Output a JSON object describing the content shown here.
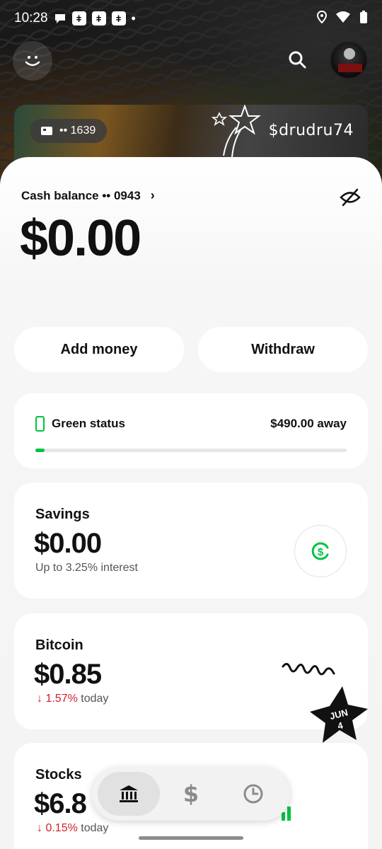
{
  "status_bar": {
    "time": "10:28",
    "dot": "•"
  },
  "header": {
    "menu_icon": "smiley-icon",
    "search_icon": "search-icon",
    "avatar": "profile-avatar"
  },
  "card": {
    "number_masked": "•• 1639",
    "cashtag": "$drudru74"
  },
  "balance": {
    "label": "Cash balance •• 0943",
    "chevron": "›",
    "amount": "$0.00"
  },
  "actions": {
    "add_money": "Add money",
    "withdraw": "Withdraw"
  },
  "green_status": {
    "label": "Green status",
    "away": "$490.00 away",
    "progress_fraction": 0.03,
    "accent": "#00c244"
  },
  "savings": {
    "title": "Savings",
    "amount": "$0.00",
    "subtitle": "Up to 3.25% interest"
  },
  "bitcoin": {
    "title": "Bitcoin",
    "amount": "$0.85",
    "change_arrow": "↓",
    "change_pct": "1.57%",
    "change_suffix": "today"
  },
  "stocks": {
    "title": "Stocks",
    "amount": "$6.8",
    "change_arrow": "↓",
    "change_pct": "0.15%",
    "change_suffix": "today"
  },
  "sticker": {
    "line1": "JUN",
    "line2": "4"
  },
  "nav": {
    "items": [
      {
        "name": "bank-icon",
        "active": true
      },
      {
        "name": "dollar-icon",
        "glyph": "$"
      },
      {
        "name": "activity-clock-icon"
      }
    ]
  },
  "colors": {
    "negative": "#d0202a",
    "positive": "#00c244"
  }
}
